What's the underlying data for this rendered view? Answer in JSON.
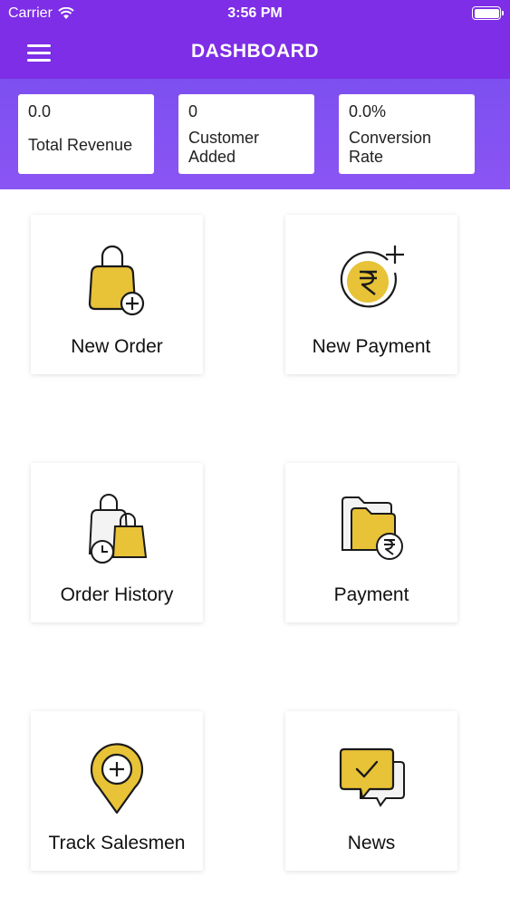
{
  "status_bar": {
    "carrier": "Carrier",
    "time": "3:56 PM"
  },
  "nav": {
    "title": "DASHBOARD"
  },
  "stats": [
    {
      "value": "0.0",
      "label": "Total Revenue"
    },
    {
      "value": "0",
      "label": "Customer Added"
    },
    {
      "value": "0.0%",
      "label": "Conversion Rate"
    }
  ],
  "tiles": [
    {
      "label": "New Order",
      "icon": "shopping-bag-plus-icon"
    },
    {
      "label": "New Payment",
      "icon": "rupee-coin-plus-icon"
    },
    {
      "label": "Order History",
      "icon": "bags-clock-icon"
    },
    {
      "label": "Payment",
      "icon": "folder-rupee-icon"
    },
    {
      "label": "Track Salesmen",
      "icon": "location-pin-plus-icon"
    },
    {
      "label": "News",
      "icon": "chat-bubble-check-icon"
    }
  ],
  "colors": {
    "accent": "#7d2ee6",
    "icon_yellow": "#e8c237",
    "icon_outline": "#1a1a1a"
  }
}
